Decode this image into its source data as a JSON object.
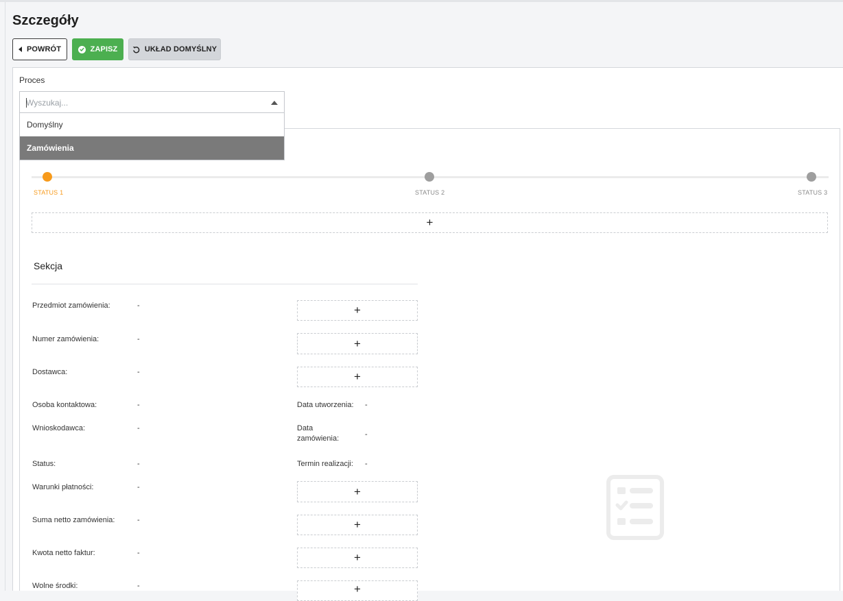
{
  "page": {
    "title": "Szczegóły"
  },
  "toolbar": {
    "back_label": "POWRÓT",
    "save_label": "ZAPISZ",
    "default_layout_label": "UKŁAD DOMYŚLNY"
  },
  "process": {
    "label": "Proces",
    "search_placeholder": "Wyszukaj...",
    "options": [
      "Domyślny",
      "Zamówienia"
    ],
    "selected": "Zamówienia"
  },
  "status_bar": {
    "steps": [
      "STATUS 1",
      "STATUS 2",
      "STATUS 3"
    ],
    "active_color": "#f79a1b",
    "inactive_color": "#9e9e9e"
  },
  "section": {
    "title": "Sekcja",
    "left_fields": [
      {
        "label": "Przedmiot zamówienia:",
        "value": "-"
      },
      {
        "label": "Numer zamówienia:",
        "value": "-"
      },
      {
        "label": "Dostawca:",
        "value": "-"
      },
      {
        "label": "Osoba kontaktowa:",
        "value": "-"
      },
      {
        "label": "Wnioskodawca:",
        "value": "-"
      },
      {
        "label": "Status:",
        "value": "-"
      },
      {
        "label": "Warunki płatności:",
        "value": "-"
      },
      {
        "label": "Suma netto zamówienia:",
        "value": "-"
      },
      {
        "label": "Kwota netto faktur:",
        "value": "-"
      },
      {
        "label": "Wolne środki:",
        "value": "-"
      }
    ],
    "right_fields": [
      {
        "label": "Data utworzenia:",
        "value": "-"
      },
      {
        "label": "Data zamówienia:",
        "value": "-"
      },
      {
        "label": "Termin realizacji:",
        "value": "-"
      }
    ],
    "add_symbol": "+"
  },
  "colors": {
    "save_green": "#4caf50",
    "selected_option_bg": "#7a7a7a"
  }
}
